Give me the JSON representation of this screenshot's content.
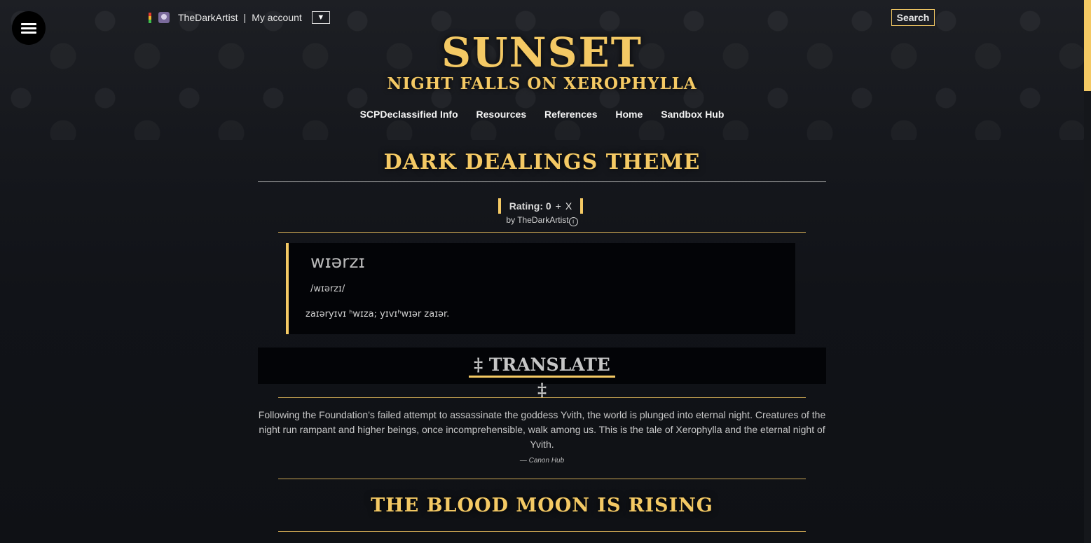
{
  "account": {
    "username": "TheDarkArtist",
    "separator": "|",
    "my_account_label": "My account",
    "toggle_glyph": "▼",
    "karma_colors": [
      "#e23b2e",
      "#f0b12b",
      "#3fbf4a"
    ]
  },
  "search": {
    "label": "Search"
  },
  "header": {
    "title": "SUNSET",
    "subtitle": "NIGHT FALLS ON XEROPHYLLA"
  },
  "topnav": [
    {
      "label": "SCPDeclassified Info"
    },
    {
      "label": "Resources"
    },
    {
      "label": "References"
    },
    {
      "label": "Home"
    },
    {
      "label": "Sandbox Hub"
    }
  ],
  "page": {
    "title": "DARK DEALINGS THEME",
    "rating_label": "Rating: 0",
    "rate_plus": "+",
    "rate_cancel": "X",
    "byline_prefix": "by",
    "author": "TheDarkArtist",
    "info_glyph": "i"
  },
  "definition": {
    "word": "wɪərzɪ",
    "pronunciation": "/wɪərzɪ/",
    "text": "zaɪəryɪvɪ ʰwɪza; yɪvɪʰwɪər zaɪər."
  },
  "translate": {
    "label": "‡ TRANSLATE ‡"
  },
  "blurb": {
    "text": "Following the Foundation's failed attempt to assassinate the goddess Yvith, the world is plunged into eternal night. Creatures of the night run rampant and higher beings, once incomprehensible, walk among us. This is the tale of Xerophylla and the eternal night of Yvith.",
    "attribution": "— Canon Hub"
  },
  "section": {
    "title": "THE BLOOD MOON IS RISING"
  },
  "colors": {
    "accent": "#f4c964",
    "background": "#111318"
  }
}
